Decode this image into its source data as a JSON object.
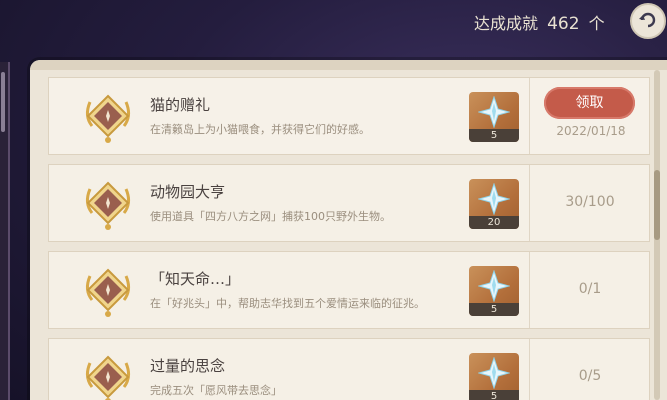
{
  "header": {
    "achievements_label": "达成成就",
    "achievements_count": "462",
    "achievements_unit": "个"
  },
  "icons": {
    "back": "back-arrow-icon",
    "badge": "achievement-badge-icon",
    "reward": "primogem-icon"
  },
  "items": [
    {
      "title": "猫的赠礼",
      "desc": "在清籁岛上为小猫喂食，并获得它们的好感。",
      "reward_count": "5",
      "status": "claim",
      "button_label": "领取",
      "date": "2022/01/18"
    },
    {
      "title": "动物园大亨",
      "desc": "使用道具「四方八方之网」捕获100只野外生物。",
      "reward_count": "20",
      "status": "progress",
      "progress": "30/100"
    },
    {
      "title": "「知天命…」",
      "desc": "在「好兆头」中，帮助志华找到五个爱情运来临的征兆。",
      "reward_count": "5",
      "status": "progress",
      "progress": "0/1"
    },
    {
      "title": "过量的思念",
      "desc": "完成五次「愿风带去思念」",
      "reward_count": "5",
      "status": "progress",
      "progress": "0/5"
    }
  ],
  "colors": {
    "claim_button": "#c45b4a",
    "panel": "#ece5d8",
    "reward_bg": "#b36f3b"
  }
}
